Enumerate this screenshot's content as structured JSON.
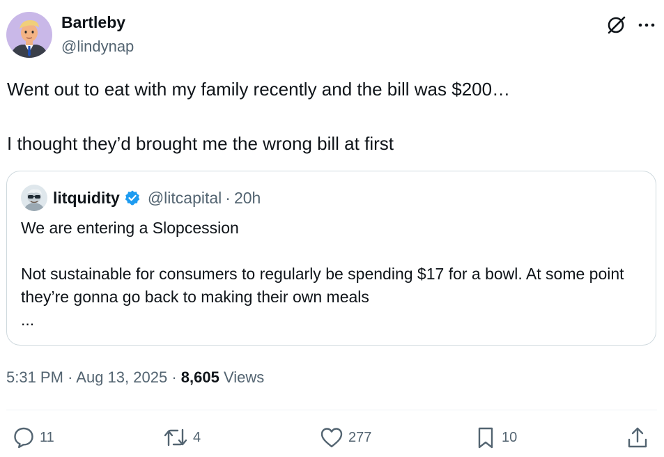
{
  "author": {
    "name": "Bartleby",
    "handle": "@lindynap"
  },
  "tweet": {
    "text": "Went out to eat with my family recently and the bill was $200…\n\nI thought they’d brought me the wrong bill at first"
  },
  "quoted": {
    "name": "litquidity",
    "verified": true,
    "handle": "@litcapital",
    "separator": "·",
    "time": "20h",
    "text": "We are entering a Slopcession\n\nNot sustainable for consumers to regularly be spending $17 for a bowl. At some point they’re gonna go back to making their own meals\n..."
  },
  "meta": {
    "time": "5:31 PM",
    "separator": "·",
    "date": "Aug 13, 2025",
    "views_count": "8,605",
    "views_label": "Views"
  },
  "actions": {
    "reply_count": "11",
    "repost_count": "4",
    "like_count": "277",
    "bookmark_count": "10"
  },
  "colors": {
    "text": "#0f1419",
    "secondary": "#536471",
    "border": "#cfd9de",
    "verified": "#1d9bf0"
  },
  "icons": {
    "grok": "grok-icon",
    "more": "more-icon",
    "reply": "reply-icon",
    "repost": "repost-icon",
    "like": "like-icon",
    "bookmark": "bookmark-icon",
    "share": "share-icon",
    "verified": "verified-badge-icon"
  }
}
